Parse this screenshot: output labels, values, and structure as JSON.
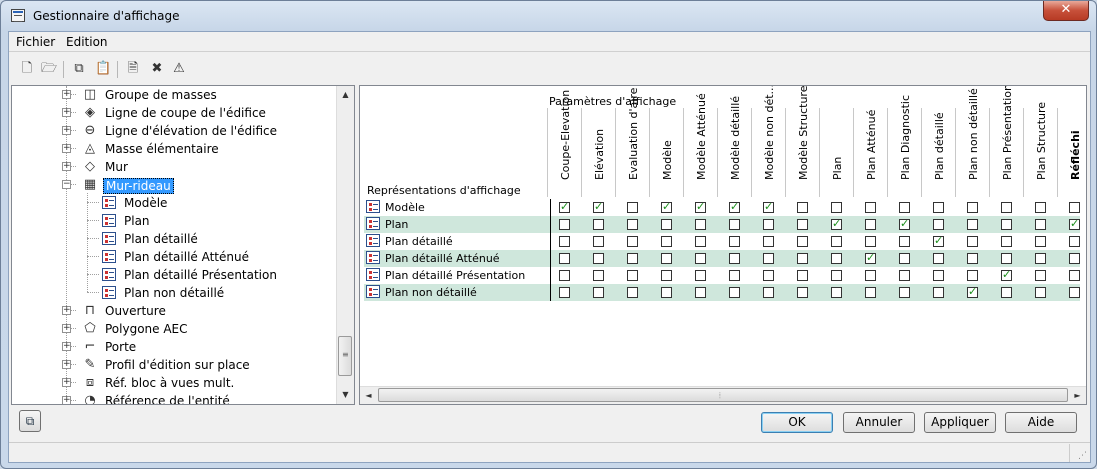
{
  "window": {
    "title": "Gestionnaire d'affichage",
    "close_glyph": "✕",
    "app_icon": "display-manager-icon"
  },
  "menu": [
    {
      "label": "Fichier"
    },
    {
      "label": "Edition"
    }
  ],
  "toolbar": [
    {
      "name": "new",
      "icon": "new-document-icon",
      "glyph": "🗋"
    },
    {
      "name": "open",
      "icon": "open-folder-icon",
      "glyph": "🗁"
    },
    {
      "name": "copy",
      "icon": "copy-icon",
      "glyph": "⧉"
    },
    {
      "name": "paste",
      "icon": "paste-icon",
      "glyph": "📋"
    },
    {
      "name": "purge",
      "icon": "purge-icon",
      "glyph": "🗎"
    },
    {
      "name": "delete",
      "icon": "delete-icon",
      "glyph": "✖"
    },
    {
      "name": "properties",
      "icon": "properties-icon",
      "glyph": "⚠"
    }
  ],
  "tree": [
    {
      "label": "Groupe de masses",
      "icon": "mass-group-icon",
      "glyph": "◫",
      "level": 0,
      "expander": "+"
    },
    {
      "label": "Ligne de coupe de l'édifice",
      "icon": "section-line-icon",
      "glyph": "◈",
      "level": 0,
      "expander": "+"
    },
    {
      "label": "Ligne d'élévation de l'édifice",
      "icon": "elevation-line-icon",
      "glyph": "⊖",
      "level": 0,
      "expander": "+"
    },
    {
      "label": "Masse élémentaire",
      "icon": "mass-element-icon",
      "glyph": "◬",
      "level": 0,
      "expander": "+"
    },
    {
      "label": "Mur",
      "icon": "wall-icon",
      "glyph": "◇",
      "level": 0,
      "expander": "+"
    },
    {
      "label": "Mur-rideau",
      "icon": "curtain-wall-icon",
      "glyph": "▦",
      "level": 0,
      "expander": "−",
      "selected": true
    },
    {
      "label": "Modèle",
      "icon": "display-rep-icon",
      "level": 1
    },
    {
      "label": "Plan",
      "icon": "display-rep-icon",
      "level": 1
    },
    {
      "label": "Plan détaillé",
      "icon": "display-rep-icon",
      "level": 1
    },
    {
      "label": "Plan détaillé Atténué",
      "icon": "display-rep-icon",
      "level": 1
    },
    {
      "label": "Plan détaillé Présentation",
      "icon": "display-rep-icon",
      "level": 1
    },
    {
      "label": "Plan non détaillé",
      "icon": "display-rep-icon",
      "level": 1
    },
    {
      "label": "Ouverture",
      "icon": "opening-icon",
      "glyph": "⊓",
      "level": 0,
      "expander": "+"
    },
    {
      "label": "Polygone AEC",
      "icon": "polygon-icon",
      "glyph": "⬠",
      "level": 0,
      "expander": "+"
    },
    {
      "label": "Porte",
      "icon": "door-icon",
      "glyph": "⌐",
      "level": 0,
      "expander": "+"
    },
    {
      "label": "Profil d'édition sur place",
      "icon": "edit-profile-icon",
      "glyph": "✎",
      "level": 0,
      "expander": "+"
    },
    {
      "label": "Réf. bloc à vues mult.",
      "icon": "multi-view-block-icon",
      "glyph": "⧈",
      "level": 0,
      "expander": "+"
    },
    {
      "label": "Référence de l'entité",
      "icon": "entity-reference-icon",
      "glyph": "◔",
      "level": 0,
      "expander": "+"
    }
  ],
  "matrix": {
    "corner_label": "Représentations d'affichage",
    "group_label": "Paramètres d'affichage",
    "columns": [
      {
        "label": "Coupe-Elevation"
      },
      {
        "label": "Elévation"
      },
      {
        "label": "Evaluation d'aire"
      },
      {
        "label": "Modèle"
      },
      {
        "label": "Modèle Atténué"
      },
      {
        "label": "Modèle détaillé"
      },
      {
        "label": "Modèle non dét..."
      },
      {
        "label": "Modèle Structure"
      },
      {
        "label": "Plan"
      },
      {
        "label": "Plan Atténué"
      },
      {
        "label": "Plan Diagnostic"
      },
      {
        "label": "Plan détaillé"
      },
      {
        "label": "Plan non détaillé"
      },
      {
        "label": "Plan Présentation"
      },
      {
        "label": "Plan Structure"
      },
      {
        "label": "Réfléchi",
        "bold": true
      }
    ],
    "rows": [
      {
        "label": "Modèle",
        "checks": [
          1,
          1,
          0,
          1,
          1,
          1,
          1,
          0,
          0,
          0,
          0,
          0,
          0,
          0,
          0,
          0
        ]
      },
      {
        "label": "Plan",
        "checks": [
          0,
          0,
          0,
          0,
          0,
          0,
          0,
          0,
          1,
          0,
          1,
          0,
          0,
          0,
          0,
          1
        ]
      },
      {
        "label": "Plan détaillé",
        "checks": [
          0,
          0,
          0,
          0,
          0,
          0,
          0,
          0,
          0,
          0,
          0,
          1,
          0,
          0,
          0,
          0
        ]
      },
      {
        "label": "Plan détaillé Atténué",
        "checks": [
          0,
          0,
          0,
          0,
          0,
          0,
          0,
          0,
          0,
          1,
          0,
          0,
          0,
          0,
          0,
          0
        ]
      },
      {
        "label": "Plan détaillé Présentation",
        "checks": [
          0,
          0,
          0,
          0,
          0,
          0,
          0,
          0,
          0,
          0,
          0,
          0,
          0,
          1,
          0,
          0
        ]
      },
      {
        "label": "Plan non détaillé",
        "checks": [
          0,
          0,
          0,
          0,
          0,
          0,
          0,
          0,
          0,
          0,
          0,
          0,
          1,
          0,
          0,
          0
        ]
      }
    ]
  },
  "scroll": {
    "up": "▲",
    "down": "▼",
    "left": "◄",
    "right": "►",
    "grip_v": "≡",
    "grip_h": "⦙"
  },
  "buttons": {
    "ok": "OK",
    "cancel": "Annuler",
    "apply": "Appliquer",
    "help": "Aide"
  },
  "colors": {
    "alt_row": "#cfe7dc",
    "selection": "#3399ff",
    "check": "#1b8f1b",
    "close_button": "#c7503a"
  }
}
